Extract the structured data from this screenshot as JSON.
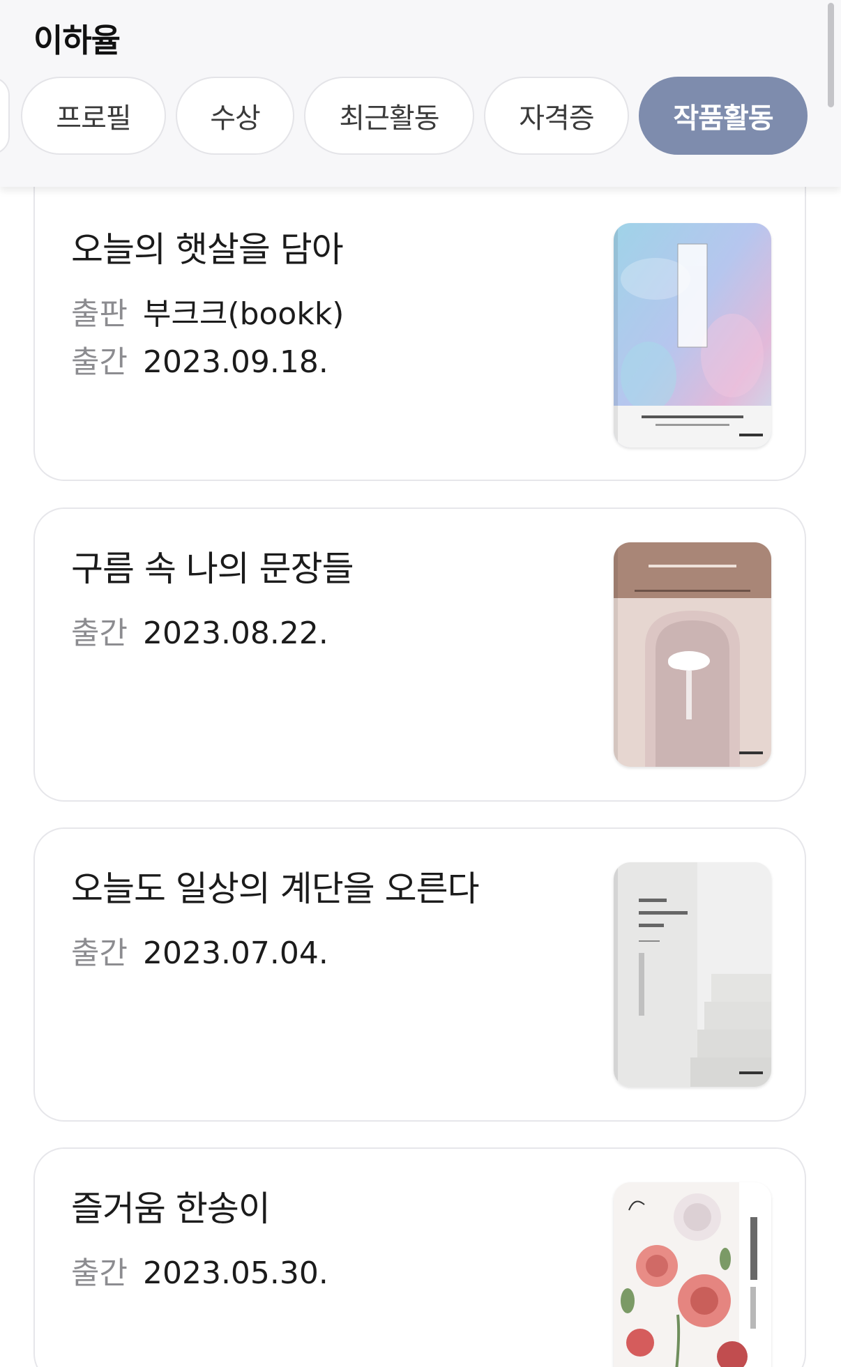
{
  "header": {
    "name": "이하율",
    "tabs": [
      {
        "label": "프로필",
        "active": false
      },
      {
        "label": "수상",
        "active": false
      },
      {
        "label": "최근활동",
        "active": false
      },
      {
        "label": "자격증",
        "active": false
      },
      {
        "label": "작품활동",
        "active": true
      }
    ]
  },
  "books": [
    {
      "title": "오늘의 햇살을 담아",
      "meta": [
        {
          "label": "출판",
          "value": "부크크(bookk)"
        },
        {
          "label": "출간",
          "value": "2023.09.18."
        }
      ],
      "cover_icon": "book-cover-sunlight"
    },
    {
      "title": "구름 속 나의 문장들",
      "meta": [
        {
          "label": "출간",
          "value": "2023.08.22."
        }
      ],
      "cover_icon": "book-cover-clouds"
    },
    {
      "title": "오늘도 일상의 계단을 오른다",
      "meta": [
        {
          "label": "출간",
          "value": "2023.07.04."
        }
      ],
      "cover_icon": "book-cover-stairs"
    },
    {
      "title": "즐거움 한송이",
      "meta": [
        {
          "label": "출간",
          "value": "2023.05.30."
        }
      ],
      "cover_icon": "book-cover-flowers"
    }
  ],
  "colors": {
    "active_tab": "#7e8cad",
    "label_gray": "#8c8c90",
    "card_border": "#e6e6ea"
  }
}
